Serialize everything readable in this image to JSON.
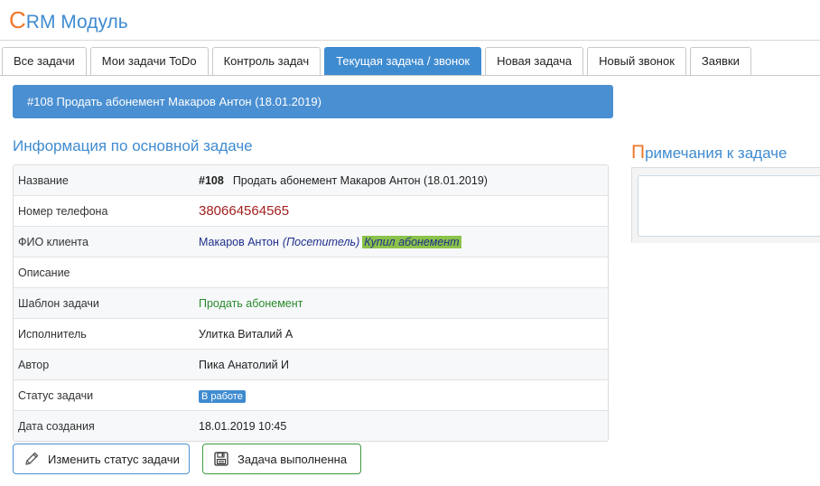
{
  "header": {
    "title_first_letter": "C",
    "title_rest": "RM Модуль"
  },
  "tabs": [
    {
      "label": "Все задачи",
      "active": false
    },
    {
      "label": "Мои задачи ToDo",
      "active": false
    },
    {
      "label": "Контроль задач",
      "active": false
    },
    {
      "label": "Текущая задача / звонок",
      "active": true
    },
    {
      "label": "Новая задача",
      "active": false
    },
    {
      "label": "Новый звонок",
      "active": false
    },
    {
      "label": "Заявки",
      "active": false
    }
  ],
  "banner": {
    "text": "#108 Продать абонемент Макаров Антон (18.01.2019)"
  },
  "main_info": {
    "title": "Информация по основной задаче",
    "rows": {
      "name": {
        "label": "Название",
        "number": "#108",
        "text": "Продать абонемент Макаров Антон (18.01.2019)"
      },
      "phone": {
        "label": "Номер телефона",
        "value": "380664564565"
      },
      "client": {
        "label": "ФИО клиента",
        "name": "Макаров Антон",
        "role": "(Посетитель)",
        "tag": "Купил абонемент"
      },
      "description": {
        "label": "Описание",
        "value": ""
      },
      "template": {
        "label": "Шаблон задачи",
        "value": "Продать абонемент"
      },
      "executor": {
        "label": "Исполнитель",
        "value": "Улитка Виталий А"
      },
      "author": {
        "label": "Автор",
        "value": "Пика Анатолий И"
      },
      "status": {
        "label": "Статус задачи",
        "value": "В работе"
      },
      "created": {
        "label": "Дата создания",
        "value": "18.01.2019 10:45"
      }
    }
  },
  "buttons": {
    "change_status": {
      "label": "Изменить статус задачи",
      "icon": "pencil-icon"
    },
    "done": {
      "label": "Задача выполненна",
      "icon": "save-icon"
    }
  },
  "notes": {
    "title_first_letter": "П",
    "title_rest": "римечания к задаче",
    "content": ""
  },
  "colors": {
    "accent_blue": "#3f8bd0",
    "accent_orange": "#f0772b",
    "phone_red": "#a31f1f",
    "tag_green": "#8bc34a",
    "done_green": "#3d9a3d"
  }
}
